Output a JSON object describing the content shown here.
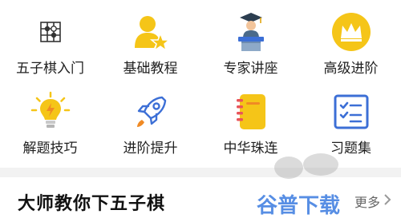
{
  "menu": {
    "items": [
      {
        "label": "五子棋入门",
        "icon": "board-grid-icon"
      },
      {
        "label": "基础教程",
        "icon": "person-star-icon"
      },
      {
        "label": "专家讲座",
        "icon": "lecture-podium-icon"
      },
      {
        "label": "高级进阶",
        "icon": "crown-icon"
      },
      {
        "label": "解题技巧",
        "icon": "lightbulb-icon"
      },
      {
        "label": "进阶提升",
        "icon": "rocket-icon"
      },
      {
        "label": "中华珠连",
        "icon": "notebook-icon"
      },
      {
        "label": "习题集",
        "icon": "checklist-icon"
      }
    ]
  },
  "section": {
    "title": "大师教你下五子棋",
    "more_label": "更多"
  },
  "watermark": {
    "text": "谷普下载"
  },
  "colors": {
    "accent_yellow": "#F5C518",
    "accent_orange": "#F08A24",
    "accent_blue": "#3C6FD6",
    "divider": "#F2F2F2"
  }
}
